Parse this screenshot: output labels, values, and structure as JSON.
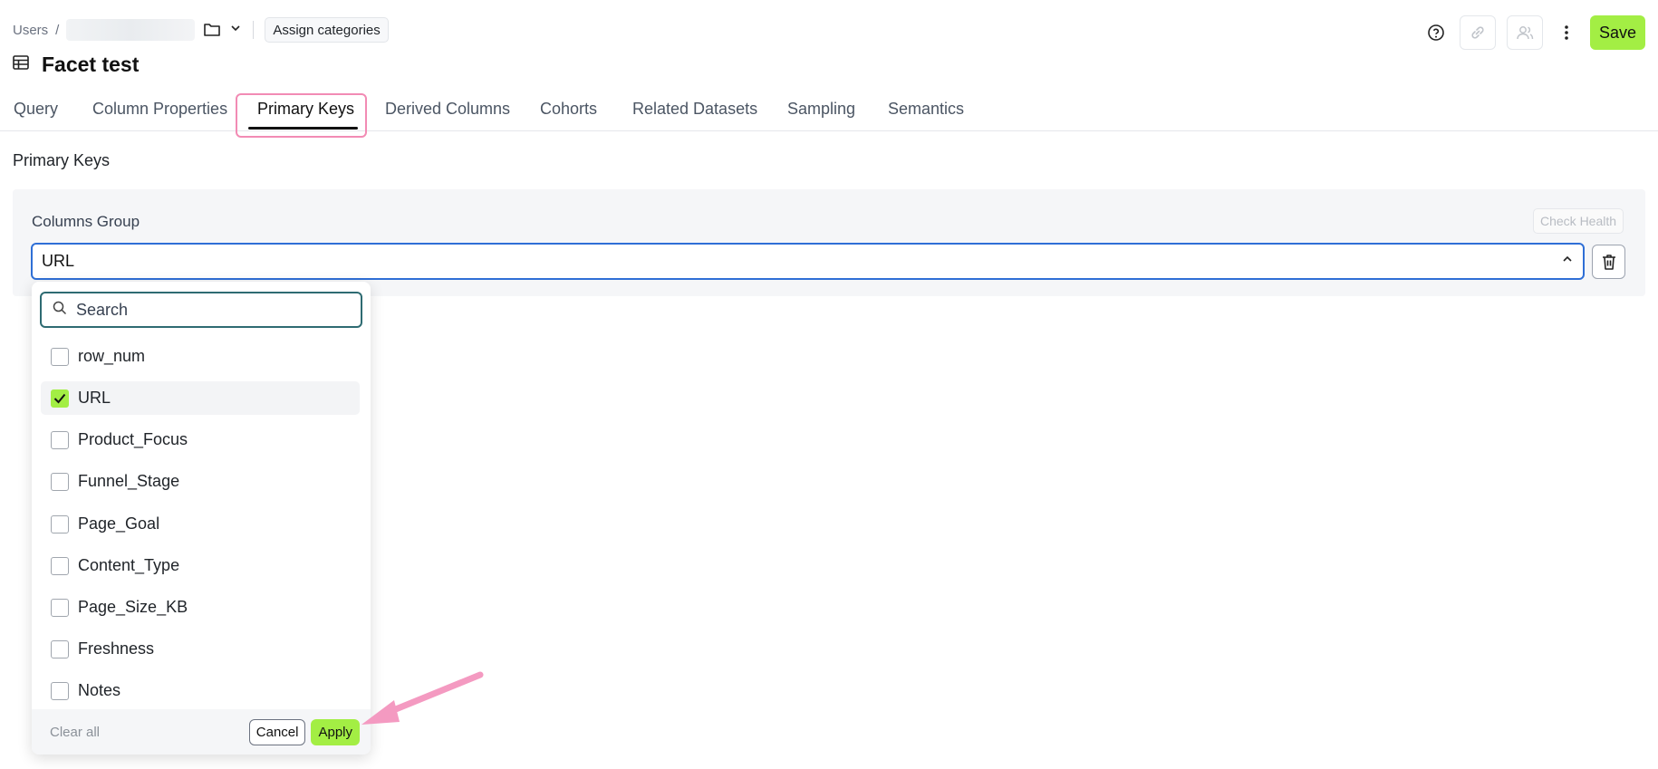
{
  "breadcrumb": {
    "root": "Users",
    "separator": "/"
  },
  "header": {
    "assign_categories": "Assign categories",
    "save_label": "Save",
    "title": "Facet test"
  },
  "tabs": [
    {
      "label": "Query"
    },
    {
      "label": "Column Properties"
    },
    {
      "label": "Primary Keys",
      "active": true
    },
    {
      "label": "Derived Columns"
    },
    {
      "label": "Cohorts"
    },
    {
      "label": "Related Datasets"
    },
    {
      "label": "Sampling"
    },
    {
      "label": "Semantics"
    }
  ],
  "section": {
    "title": "Primary Keys"
  },
  "columns_group": {
    "label": "Columns Group",
    "check_health": "Check Health",
    "selected_value": "URL"
  },
  "dropdown": {
    "search_placeholder": "Search",
    "options": [
      {
        "label": "row_num",
        "checked": false
      },
      {
        "label": "URL",
        "checked": true
      },
      {
        "label": "Product_Focus",
        "checked": false
      },
      {
        "label": "Funnel_Stage",
        "checked": false
      },
      {
        "label": "Page_Goal",
        "checked": false
      },
      {
        "label": "Content_Type",
        "checked": false
      },
      {
        "label": "Page_Size_KB",
        "checked": false
      },
      {
        "label": "Freshness",
        "checked": false
      },
      {
        "label": "Notes",
        "checked": false
      }
    ],
    "clear_all": "Clear all",
    "cancel": "Cancel",
    "apply": "Apply"
  },
  "colors": {
    "accent": "#a3ee44",
    "focus": "#2f6fd6",
    "highlight": "#f28bb4"
  },
  "icons": [
    "table-icon",
    "folder-icon",
    "chevron-down-icon",
    "help-icon",
    "link-icon",
    "users-icon",
    "more-vertical-icon",
    "chevron-up-icon",
    "trash-icon",
    "search-icon",
    "check-icon"
  ]
}
